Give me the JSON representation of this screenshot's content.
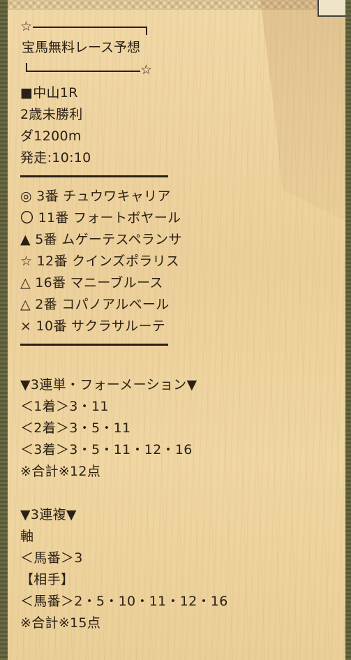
{
  "title_box": {
    "star_top": "☆",
    "title": "宝馬無料レース予想",
    "star_bottom": "☆"
  },
  "race": {
    "venue": "■中山1R",
    "class": "2歳未勝利",
    "course": "ダ1200m",
    "start": "発走:10:10"
  },
  "picks": [
    "◎ 3番 チュウワキャリア",
    "〇 11番 フォートボヤール",
    "▲ 5番 ムゲーテスペランサ",
    "☆ 12番 クインズポラリス",
    "△ 16番 マニーブルース",
    "△ 2番 コパノアルベール",
    "× 10番 サクラサルーテ"
  ],
  "trifecta": {
    "header": "▼3連単・フォーメーション▼",
    "first": "＜1着＞3・11",
    "second": "＜2着＞3・5・11",
    "third": "＜3着＞3・5・11・12・16",
    "total": "※合計※12点"
  },
  "trio": {
    "header": "▼3連複▼",
    "axis_label": "軸",
    "axis": "＜馬番＞3",
    "partner_label": "【相手】",
    "partners": "＜馬番＞2・5・10・11・12・16",
    "total": "※合計※15点"
  }
}
